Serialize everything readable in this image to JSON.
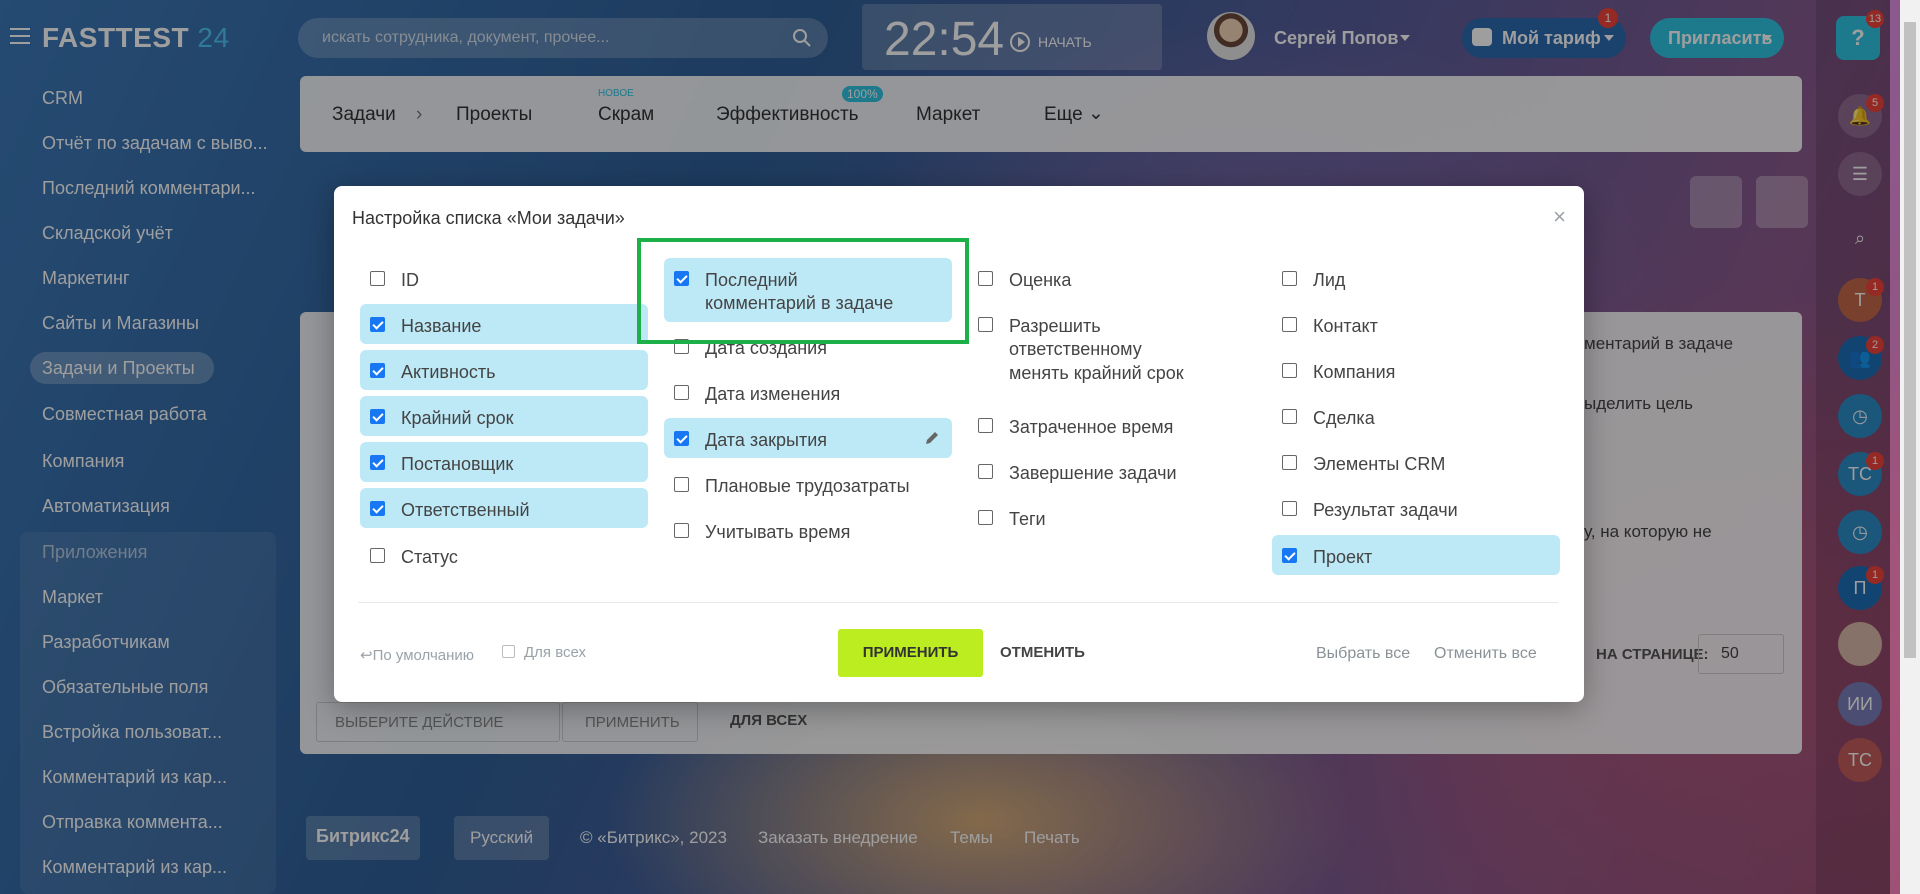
{
  "header": {
    "logo_main": "FASTTEST",
    "logo_num": "24",
    "search_placeholder": "искать сотрудника, документ, прочее...",
    "clock_time": "22:54",
    "clock_start": "НАЧАТЬ",
    "user_name": "Сергей Попов",
    "tariff_label": "Мой тариф",
    "tariff_badge": "1",
    "invite_label": "Пригласить",
    "help_badge": "13"
  },
  "sidebar": {
    "items": [
      {
        "label": "CRM"
      },
      {
        "label": "Отчёт по задачам с выво..."
      },
      {
        "label": "Последний комментари..."
      },
      {
        "label": "Складской учёт"
      },
      {
        "label": "Маркетинг"
      },
      {
        "label": "Сайты и Магазины"
      },
      {
        "label": "Задачи и Проекты"
      },
      {
        "label": "Совместная работа"
      },
      {
        "label": "Компания"
      },
      {
        "label": "Автоматизация"
      },
      {
        "label": "Приложения"
      },
      {
        "label": "Маркет"
      },
      {
        "label": "Разработчикам"
      },
      {
        "label": "Обязательные поля"
      },
      {
        "label": "Встройка пользоват..."
      },
      {
        "label": "Комментарий из кар..."
      },
      {
        "label": "Отправка коммента..."
      },
      {
        "label": "Комментарий из кар..."
      }
    ]
  },
  "tabs": {
    "tasks": "Задачи",
    "projects": "Проекты",
    "scrum": "Скрам",
    "scrum_badge": "НОВОЕ",
    "efficiency": "Эффективность",
    "efficiency_badge": "100%",
    "market": "Маркет",
    "more": "Еще"
  },
  "background": {
    "col_header_fragment": "ментарий в задаче",
    "row1_fragment": "ыделить цель",
    "row2_fragment": "у, на которую не",
    "per_page_label": "НА СТРАНИЦЕ:",
    "per_page_value": "50",
    "action_select": "ВЫБЕРИТЕ ДЕЙСТВИЕ",
    "action_apply": "ПРИМЕНИТЬ",
    "for_all": "ДЛЯ ВСЕХ"
  },
  "footer": {
    "brand": "Битрикс24",
    "language": "Русский",
    "copyright": "© «Битрикс», 2023",
    "order": "Заказать внедрение",
    "themes": "Темы",
    "print": "Печать"
  },
  "rightbar": {
    "notif_badge": "5",
    "badges": [
      "1",
      "2",
      "1",
      "1"
    ],
    "initials": [
      "Т",
      "ТС",
      "П",
      "ИИ",
      "ТС"
    ]
  },
  "modal": {
    "title": "Настройка списка «Мои задачи»",
    "col1": [
      {
        "label": "ID",
        "checked": false
      },
      {
        "label": "Название",
        "checked": true
      },
      {
        "label": "Активность",
        "checked": true
      },
      {
        "label": "Крайний срок",
        "checked": true
      },
      {
        "label": "Постановщик",
        "checked": true
      },
      {
        "label": "Ответственный",
        "checked": true
      },
      {
        "label": "Статус",
        "checked": false
      }
    ],
    "col2": [
      {
        "label": "Последний комментарий в задаче",
        "checked": true
      },
      {
        "label": "Дата создания",
        "checked": false
      },
      {
        "label": "Дата изменения",
        "checked": false
      },
      {
        "label": "Дата закрытия",
        "checked": true
      },
      {
        "label": "Плановые трудозатраты",
        "checked": false
      },
      {
        "label": "Учитывать время",
        "checked": false
      }
    ],
    "col3": [
      {
        "label": "Оценка",
        "checked": false
      },
      {
        "label": "Разрешить ответственному менять крайний срок",
        "checked": false
      },
      {
        "label": "Затраченное время",
        "checked": false
      },
      {
        "label": "Завершение задачи",
        "checked": false
      },
      {
        "label": "Теги",
        "checked": false
      }
    ],
    "col4": [
      {
        "label": "Лид",
        "checked": false
      },
      {
        "label": "Контакт",
        "checked": false
      },
      {
        "label": "Компания",
        "checked": false
      },
      {
        "label": "Сделка",
        "checked": false
      },
      {
        "label": "Элементы CRM",
        "checked": false
      },
      {
        "label": "Результат задачи",
        "checked": false
      },
      {
        "label": "Проект",
        "checked": true
      }
    ],
    "default_link": "По умолчанию",
    "for_all": "Для всех",
    "apply": "ПРИМЕНИТЬ",
    "cancel": "ОТМЕНИТЬ",
    "select_all": "Выбрать все",
    "deselect_all": "Отменить все"
  },
  "colors": {
    "accent": "#bbed21",
    "highlight": "#1db049",
    "selected_row": "#bde9f7",
    "checkbox": "#1877f2"
  }
}
